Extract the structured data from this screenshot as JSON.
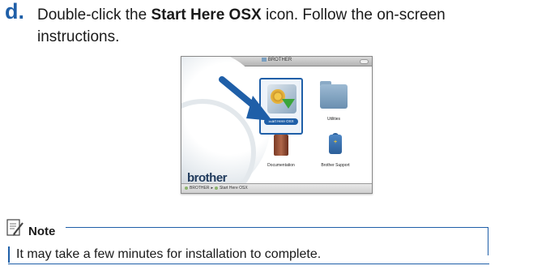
{
  "step": {
    "letter": "d.",
    "line1_pre": "Double-click the ",
    "line1_bold": "Start Here OSX",
    "line1_post": " icon. Follow the on-screen",
    "line2": "instructions."
  },
  "finder": {
    "window_title": "BROTHER",
    "items": [
      {
        "label": "Start Here OSX",
        "icon": "gear-installer-icon",
        "selected": true
      },
      {
        "label": "Utilities",
        "icon": "folder-icon"
      },
      {
        "label": "Documentation",
        "icon": "documentation-icon"
      },
      {
        "label": "Brother Support",
        "icon": "support-icon"
      }
    ],
    "brand": "brother",
    "path": {
      "root": "BROTHER",
      "separator": "▸",
      "current": "Start Here OSX"
    }
  },
  "note": {
    "title": "Note",
    "text": "It may take a few minutes for installation to complete."
  },
  "colors": {
    "accent": "#1f5fa8"
  }
}
